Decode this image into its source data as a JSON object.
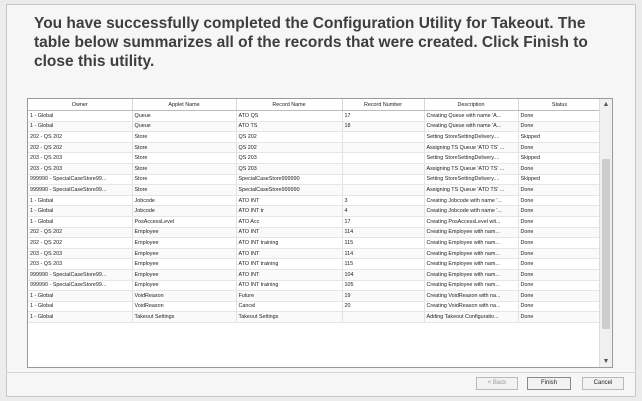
{
  "heading": "You have successfully completed the Configuration Utility for Takeout. The table below summarizes all of the records that were created. Click Finish to close this utility.",
  "table": {
    "columns": [
      "Owner",
      "Applet Name",
      "Record Name",
      "Record Number",
      "Description",
      "Status"
    ],
    "rows": [
      [
        "1 - Global",
        "Queue",
        "ATO QS",
        "17",
        "Creating Queue with name 'A...",
        "Done"
      ],
      [
        "1 - Global",
        "Queue",
        "ATO TS",
        "18",
        "Creating Queue with name 'A...",
        "Done"
      ],
      [
        "202 - QS 202",
        "Store",
        "QS 202",
        "",
        "Setting StoreSettingDelivery....",
        "Skipped"
      ],
      [
        "202 - QS 202",
        "Store",
        "QS 202",
        "",
        "Assigning TS Queue 'ATO TS' ...",
        "Done"
      ],
      [
        "203 - QS 203",
        "Store",
        "QS 203",
        "",
        "Setting StoreSettingDelivery....",
        "Skipped"
      ],
      [
        "203 - QS 203",
        "Store",
        "QS 203",
        "",
        "Assigning TS Queue 'ATO TS' ...",
        "Done"
      ],
      [
        "999990 - SpecialCaseStore99...",
        "Store",
        "SpecialCaseStore999990",
        "",
        "Setting StoreSettingDelivery....",
        "Skipped"
      ],
      [
        "999990 - SpecialCaseStore99...",
        "Store",
        "SpecialCaseStore999990",
        "",
        "Assigning TS Queue 'ATO TS' ...",
        "Done"
      ],
      [
        "1 - Global",
        "Jobcode",
        "ATO INT",
        "3",
        "Creating Jobcode with name '...",
        "Done"
      ],
      [
        "1 - Global",
        "Jobcode",
        "ATO INT tr",
        "4",
        "Creating Jobcode with name '...",
        "Done"
      ],
      [
        "1 - Global",
        "PosAccessLevel",
        "ATO Acc",
        "17",
        "Creating PosAccessLevel wit...",
        "Done"
      ],
      [
        "202 - QS 202",
        "Employee",
        "ATO INT",
        "114",
        "Creating Employee with nam...",
        "Done"
      ],
      [
        "202 - QS 202",
        "Employee",
        "ATO INT training",
        "115",
        "Creating Employee with nam...",
        "Done"
      ],
      [
        "203 - QS 203",
        "Employee",
        "ATO INT",
        "114",
        "Creating Employee with nam...",
        "Done"
      ],
      [
        "203 - QS 203",
        "Employee",
        "ATO INT training",
        "115",
        "Creating Employee with nam...",
        "Done"
      ],
      [
        "999990 - SpecialCaseStore99...",
        "Employee",
        "ATO INT",
        "104",
        "Creating Employee with nam...",
        "Done"
      ],
      [
        "999990 - SpecialCaseStore99...",
        "Employee",
        "ATO INT training",
        "105",
        "Creating Employee with nam...",
        "Done"
      ],
      [
        "1 - Global",
        "VoidReason",
        "Future",
        "19",
        "Creating VoidReason with na...",
        "Done"
      ],
      [
        "1 - Global",
        "VoidReason",
        "Cancel",
        "20",
        "Creating VoidReason with na...",
        "Done"
      ],
      [
        "1 - Global",
        "Takeout Settings",
        "Takeout Settings",
        "",
        "Adding Takeout Configuratio...",
        "Done"
      ]
    ]
  },
  "buttons": {
    "back": "< Back",
    "finish": "Finish",
    "cancel": "Cancel"
  },
  "icons": {
    "scroll_up": "chevron-up-icon",
    "scroll_down": "chevron-down-icon"
  }
}
